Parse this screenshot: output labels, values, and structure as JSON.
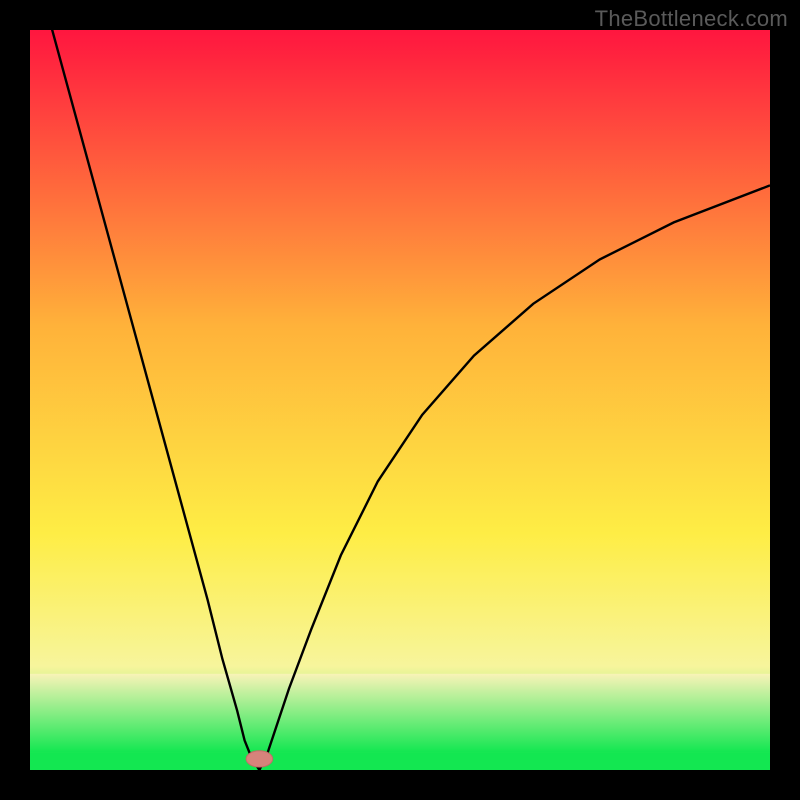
{
  "watermark": "TheBottleneck.com",
  "colors": {
    "frame": "#000000",
    "curve": "#000000",
    "marker_fill": "#d6837b",
    "marker_stroke": "#c16e66",
    "green_band": "#13e751",
    "band_top": "#f9f3b7",
    "grad_top": "#ff163f",
    "grad_mid": "#ffb23a",
    "grad_yellow": "#feed45",
    "grad_bottom_start": "#f7f59c"
  },
  "chart_data": {
    "type": "line",
    "title": "",
    "xlabel": "",
    "ylabel": "",
    "xlim": [
      0,
      100
    ],
    "ylim": [
      0,
      100
    ],
    "min_x": 31,
    "min_y": 0,
    "marker": {
      "x": 31,
      "y": 1.5,
      "rx": 1.8,
      "ry": 1.1
    },
    "series": [
      {
        "name": "bottleneck-curve",
        "x": [
          0,
          3,
          6,
          9,
          12,
          15,
          18,
          21,
          24,
          26,
          28,
          29,
          30,
          31,
          32,
          33,
          35,
          38,
          42,
          47,
          53,
          60,
          68,
          77,
          87,
          100
        ],
        "values": [
          112,
          100,
          89,
          78,
          67,
          56,
          45,
          34,
          23,
          15,
          8,
          4,
          1.5,
          0,
          2,
          5,
          11,
          19,
          29,
          39,
          48,
          56,
          63,
          69,
          74,
          79
        ]
      }
    ],
    "bands": [
      {
        "name": "green-base",
        "y0": 0,
        "y1": 2.4
      },
      {
        "name": "yellow-green-fade",
        "y0": 2.4,
        "y1": 13
      }
    ]
  }
}
